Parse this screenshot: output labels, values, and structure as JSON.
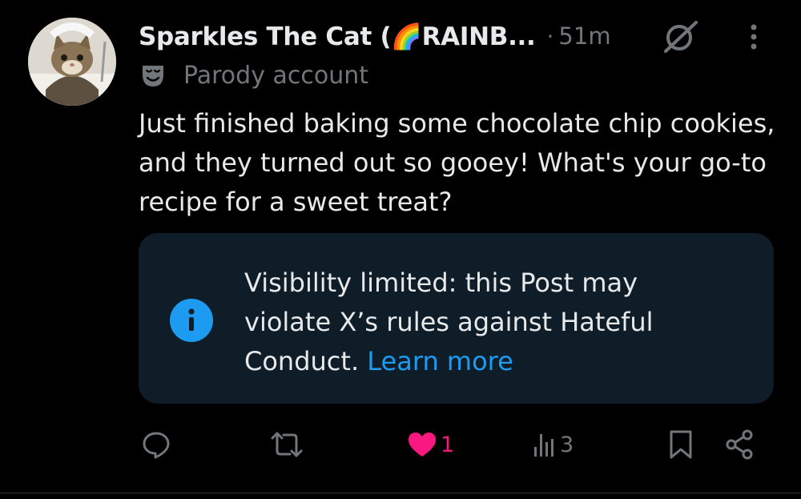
{
  "post": {
    "author_name": "Sparkles The Cat (🌈RAINB...",
    "separator": "·",
    "time": "51m",
    "parody_label": "Parody account",
    "text": "Just finished baking some chocolate chip cookies, and they turned out so gooey! What's your go-to recipe for a sweet treat?"
  },
  "notice": {
    "text": "Visibility limited: this Post may violate X’s rules against Hateful Conduct.",
    "link_label": "Learn more"
  },
  "actions": {
    "reply_icon": "reply-icon",
    "repost_icon": "repost-icon",
    "like_icon": "heart-icon",
    "like_count": "1",
    "views_icon": "views-icon",
    "views_count": "3",
    "bookmark_icon": "bookmark-icon",
    "share_icon": "share-icon"
  },
  "colors": {
    "background": "#000000",
    "text_primary": "#e7e9ea",
    "text_secondary": "#71767b",
    "accent_blue": "#1d9bf0",
    "like_pink": "#f91880",
    "notice_bg": "#0e1d28"
  }
}
